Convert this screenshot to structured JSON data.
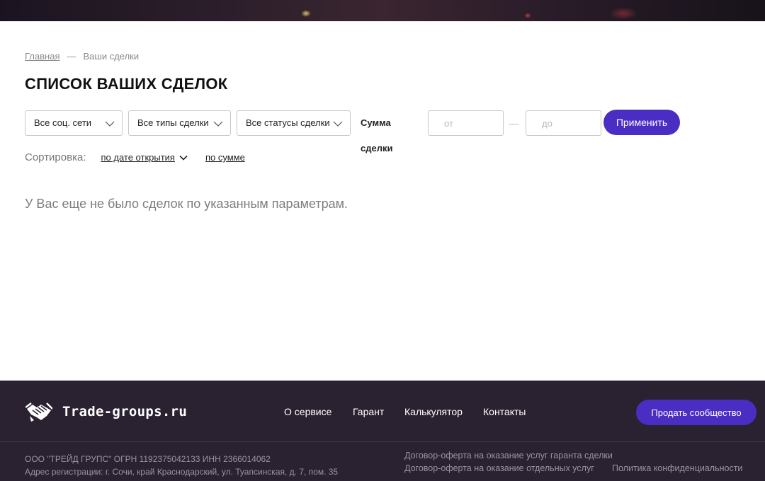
{
  "breadcrumb": {
    "home": "Главная",
    "separator": "—",
    "current": "Ваши сделки"
  },
  "page_title": "СПИСОК ВАШИХ СДЕЛОК",
  "filters": {
    "social": "Все соц. сети",
    "deal_type": "Все типы сделки",
    "deal_status": "Все статусы сделки",
    "sum_label": "Сумма сделки",
    "from_placeholder": "от",
    "to_placeholder": "до",
    "range_dash": "—",
    "apply": "Применить"
  },
  "sort": {
    "label": "Сортировка:",
    "by_date": "по дате открытия",
    "by_sum": "по сумме"
  },
  "empty_message": "У Вас еще не было сделок по указанным параметрам.",
  "footer": {
    "logo_text": "Trade-groups.ru",
    "nav": [
      "О сервисе",
      "Гарант",
      "Калькулятор",
      "Контакты"
    ],
    "sell_button": "Продать сообщество",
    "company": "ООО \"ТРЕЙД ГРУПС\" ОГРН 1192375042133 ИНН 2366014062",
    "address": "Адрес регистрации: г. Сочи, край Краснодарский, ул. Туапсинская, д. 7, пом. 35",
    "links": {
      "guarantee_offer": "Договор-оферта на оказание услуг гаранта сделки",
      "services_offer": "Договор-оферта на оказание отдельных услуг",
      "privacy": "Политика конфиденциальности"
    }
  },
  "colors": {
    "accent": "#4a2ec4",
    "footer_bg": "#2b2231",
    "text_muted": "#7d7d7d"
  }
}
